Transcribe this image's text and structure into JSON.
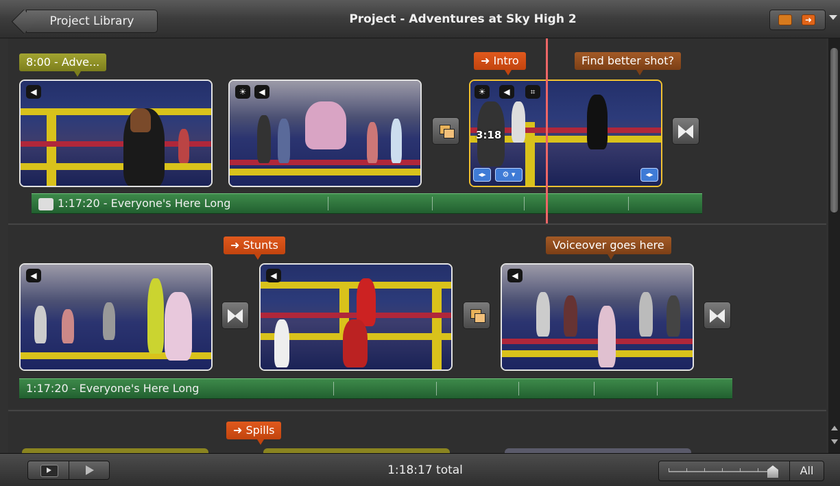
{
  "titlebar": {
    "back_label": "Project Library",
    "title": "Project - Adventures at Sky High 2"
  },
  "rows": [
    {
      "title_marker": "8:00 - Adve...",
      "chapter_marker": "➜ Intro",
      "comment_marker": "Find better shot?",
      "clip_duration": "3:18",
      "music": "1:17:20 - Everyone's Here Long"
    },
    {
      "chapter_marker": "➜ Stunts",
      "comment_marker": "Voiceover goes here",
      "music": "1:17:20 - Everyone's Here Long"
    },
    {
      "chapter_marker": "➜ Spills"
    }
  ],
  "footer": {
    "total": "1:18:17 total",
    "zoom_label": "All"
  },
  "colors": {
    "chapter": "#d6511a",
    "comment": "#8e4b1e",
    "title": "#8f9126",
    "music": "#2f7a3c",
    "playhead": "#ee6666"
  }
}
